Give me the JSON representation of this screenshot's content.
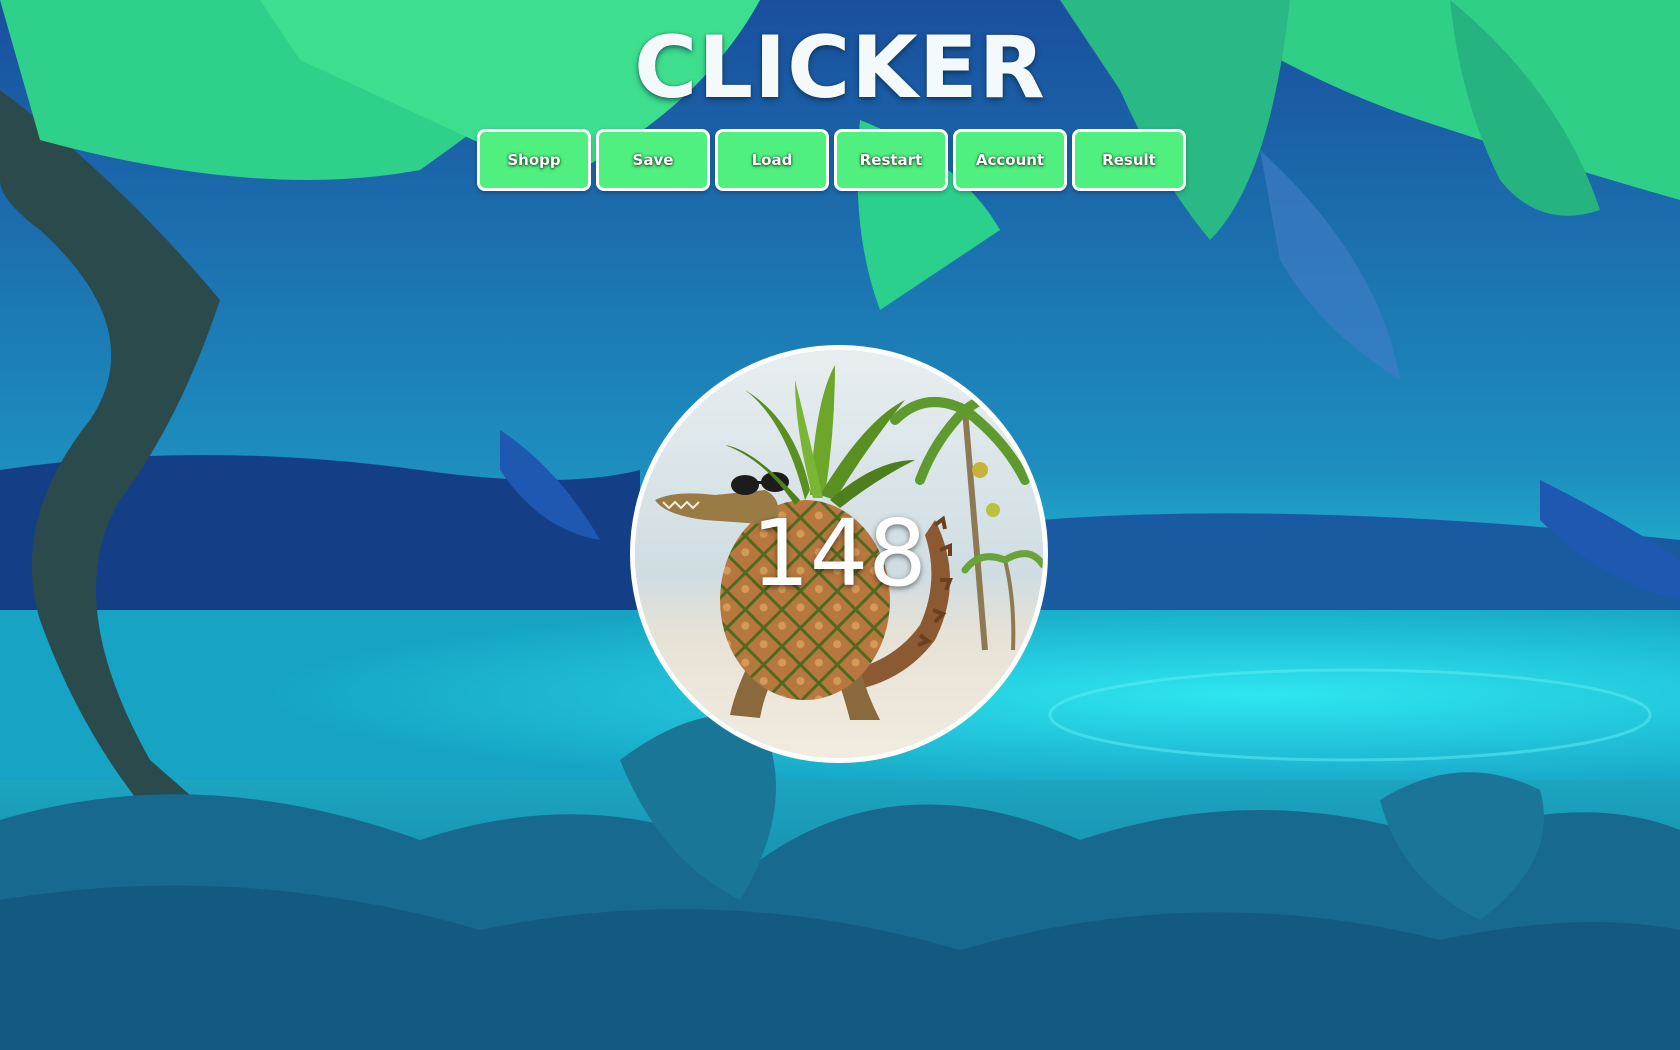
{
  "app": {
    "title": "CLICKER"
  },
  "menu": {
    "buttons": [
      {
        "label": "Shopp"
      },
      {
        "label": "Save"
      },
      {
        "label": "Load"
      },
      {
        "label": "Restart"
      },
      {
        "label": "Account"
      },
      {
        "label": "Result"
      }
    ]
  },
  "clicker": {
    "score": "148",
    "image_icon": "pineapple-crocodile-with-sunglasses"
  },
  "theme": {
    "button_color": "#4ff07f",
    "button_border": "#ffffff",
    "title_color": "#f4f9fb"
  }
}
